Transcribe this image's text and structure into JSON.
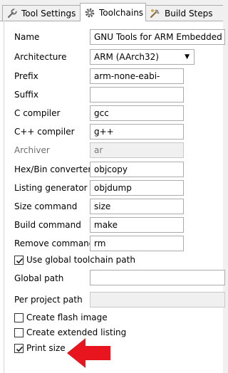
{
  "tabs": [
    {
      "label": "Tool Settings"
    },
    {
      "label": "Toolchains"
    },
    {
      "label": "Build Steps"
    }
  ],
  "form": {
    "name": {
      "label": "Name",
      "value": "GNU Tools for ARM Embedded Processors"
    },
    "architecture": {
      "label": "Architecture",
      "value": "ARM (AArch32)"
    },
    "prefix": {
      "label": "Prefix",
      "value": "arm-none-eabi-"
    },
    "suffix": {
      "label": "Suffix",
      "value": ""
    },
    "c_compiler": {
      "label": "C compiler",
      "value": "gcc"
    },
    "cpp_compiler": {
      "label": "C++ compiler",
      "value": "g++"
    },
    "archiver": {
      "label": "Archiver",
      "value": "ar"
    },
    "hexbin": {
      "label": "Hex/Bin converter",
      "value": "objcopy"
    },
    "listing": {
      "label": "Listing generator",
      "value": "objdump"
    },
    "size": {
      "label": "Size command",
      "value": "size"
    },
    "build": {
      "label": "Build command",
      "value": "make"
    },
    "remove": {
      "label": "Remove command",
      "value": "rm"
    },
    "use_global_path": {
      "label": "Use global toolchain path",
      "checked": true
    },
    "global_path": {
      "label": "Global path",
      "value": ""
    },
    "per_project_path": {
      "label": "Per project path",
      "value": ""
    },
    "create_flash": {
      "label": "Create flash image",
      "checked": false
    },
    "create_listing": {
      "label": "Create extended listing",
      "checked": false
    },
    "print_size": {
      "label": "Print size",
      "checked": true
    }
  },
  "colors": {
    "annotation_arrow": "#e8141e"
  }
}
